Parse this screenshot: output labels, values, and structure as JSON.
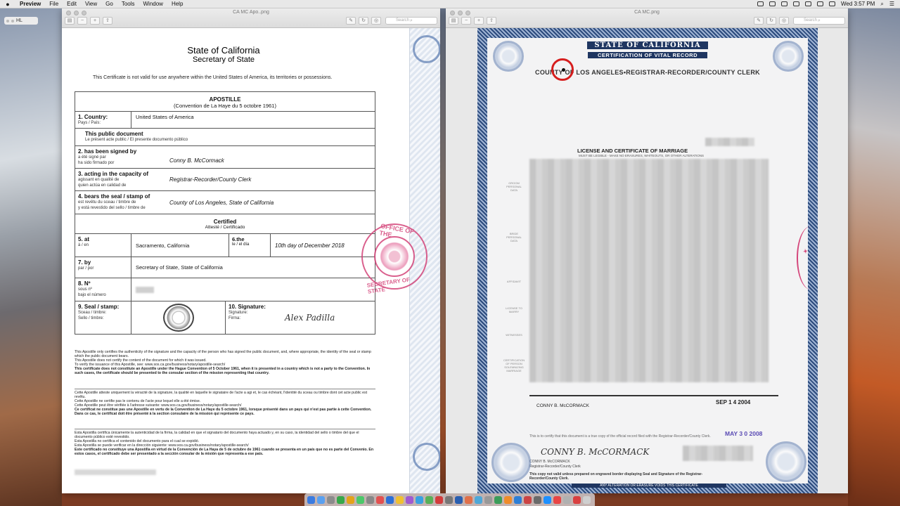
{
  "menubar": {
    "app": "Preview",
    "items": [
      "File",
      "Edit",
      "View",
      "Go",
      "Tools",
      "Window",
      "Help"
    ],
    "clock": "Wed 3:57 PM"
  },
  "desktop_chip": "HL",
  "left_window": {
    "title": "CA MC Apo..png",
    "search_placeholder": "Search",
    "doc": {
      "heading1": "State of California",
      "heading2": "Secretary of State",
      "note": "This Certificate is not valid for use anywhere within the United States of America, its territories or possessions.",
      "apostille_title": "APOSTILLE",
      "apostille_sub": "(Convention de La Haye du 5 octobre 1961)",
      "rows": {
        "country_label": "1.  Country:",
        "country_sub": "Pays / País:",
        "country_value": "United States of America",
        "public_doc": "This public document",
        "public_doc_sub": "Le présent acte public / El presente documento público",
        "signed_label": "2.  has been signed by",
        "signed_sub1": "a été signé par",
        "signed_sub2": "ha sido firmado por",
        "signed_value": "Conny B. McCormack",
        "capacity_label": "3.  acting in the capacity of",
        "capacity_sub1": "agissant en qualité de",
        "capacity_sub2": "quien actúa en calidad de",
        "capacity_value": "Registrar-Recorder/County Clerk",
        "seal_label": "4.  bears the seal / stamp of",
        "seal_sub1": "est revêtu du sceau / timbre de",
        "seal_sub2": "y está revestido del sello / timbre de",
        "seal_value": "County of Los Angeles,  State of California",
        "certified": "Certified",
        "certified_sub": "Attesté / Certificado",
        "at_label": "5.  at",
        "at_sub": "à / en",
        "at_value": "Sacramento, California",
        "the_label": "6.the",
        "the_sub": "le / el día",
        "the_value": "10th day of December 2018",
        "by_label": "7.  by",
        "by_sub": "par / por",
        "by_value": "Secretary of State, State of California",
        "no_label": "8.  Nº",
        "no_sub1": "sous nº",
        "no_sub2": "bajo el número",
        "sealstamp_label": "9.  Seal / stamp:",
        "sealstamp_sub1": "Sceau / timbre:",
        "sealstamp_sub2": "Sello / timbre:",
        "signature_label": "10.  Signature:",
        "signature_sub1": "Signature:",
        "signature_sub2": "Firma:",
        "signature_value": "Alex Padilla"
      },
      "fine_en_1": "This Apostille only certifies the authenticity of the signature and the capacity of the person who has signed the public document, and, where appropriate, the identity of the seal or stamp which the public document bears.",
      "fine_en_2": "This Apostille does not certify the content of the document for which it was issued.",
      "fine_en_3": "To verify the issuance of this Apostille, see: www.sos.ca.gov/business/notary/apostille-search/",
      "fine_en_4": "This certificate does not constitute an Apostille under the Hague Convention of 5 October 1961, when it is presented in a country which is not a party to the Convention.  In such cases, the certificate should be presented to the consular section of the mission representing that country.",
      "fine_fr_1": "Cette Apostille atteste uniquement la véracité de la signature, la qualité en laquelle le signataire de l'acte a agi et, le cas échéant, l'identité du sceau ou timbre dont cet acte public est revêtu.",
      "fine_fr_2": "Cette Apostille ne certifie pas le contenu de l'acte pour lequel elle a été émise.",
      "fine_fr_3": "Cette Apostille peut être vérifiée à l'adresse suivante: www.sos.ca.gov/business/notary/apostille-search/",
      "fine_fr_4": "Ce certificat ne constitue pas une Apostille en vertu de la Convention de La Haye du 5 octobre 1961, lorsque présenté dans un pays qui n'est pas partie à cette Convention.  Dans ce cas, le certificat doit être présenté à la section consulaire de la mission qui représente ce pays.",
      "fine_es_1": "Esta Apostilla certifica únicamente la autenticidad de la firma, la calidad en que el signatario del documento haya actuado y, en su caso, la identidad del sello o timbre del que el documento público esté revestido.",
      "fine_es_2": "Esta Apostilla no certifica el contenido del documento para el cual se expidió.",
      "fine_es_3": "Esta Apostilla se puede verificar en la dirección siguiente: www.sos.ca.gov/business/notary/apostille-search/",
      "fine_es_4": "Este certificado no constituye una Apostilla en virtud de la Convención de La Haya de 5 de octubre de 1961 cuando se presenta en un país que no es parte del Convenio.  En estos casos, el certificado debe ser presentado a la sección consular de la misión que representa a ese país.",
      "red_seal_top": "OFFICE OF THE",
      "red_seal_bottom": "SECRETARY OF STATE"
    }
  },
  "right_window": {
    "title": "CA MC.png",
    "search_placeholder": "Search",
    "cert": {
      "band1": "STATE OF CALIFORNIA",
      "band2": "CERTIFICATION OF VITAL RECORD",
      "county": "COUNTY OF LOS ANGELES•REGISTRAR-RECORDER/COUNTY CLERK",
      "license_title": "LICENSE AND CERTIFICATE OF MARRIAGE",
      "license_sub": "MUST BE LEGIBLE - MAKE NO ERASURES, WHITEOUTS, OR OTHER ALTERATIONS",
      "left_labels": [
        "GROOM PERSONAL DATA",
        "BRIDE PERSONAL DATA",
        "AFFIDAVIT",
        "LICENSE TO MARRY",
        "WITNESSES",
        "CERTIFICATION OF PERSON SOLEMNIZING MARRIAGE"
      ],
      "registrar": "CONNY B. McCORMACK",
      "date_accepted": "SEP 1 4 2004",
      "note": "This is to certify that this document is a true copy of the official record filed with the Registrar-Recorder/County Clerk.",
      "date_stamp": "MAY 3 0 2008",
      "sig_name": "CONNY B. McCORMACK",
      "sig_title": "Registrar-Recorder/County Clerk",
      "valid_note": "This copy not valid unless prepared on engraved border displaying Seal and Signature of the Registrar-Recorder/County Clerk.",
      "bottom_band": "ANY ALTERATION OR ERASURE VOIDS THIS CERTIFICATE"
    }
  },
  "dock_colors": [
    "#3b7be0",
    "#5aa0f0",
    "#8c8c8c",
    "#37a84a",
    "#e4a21a",
    "#4cc86a",
    "#888888",
    "#e35050",
    "#2b6fd8",
    "#f0c030",
    "#a05ad0",
    "#3aa0e0",
    "#58b058",
    "#d33c3c",
    "#777777",
    "#2a5fb0",
    "#e0704a",
    "#4fa8d8",
    "#999999",
    "#3c9d5a",
    "#ef8c2a",
    "#2e7fd6",
    "#c44",
    "#6a6a6a",
    "#1e90ff",
    "#e84545",
    "#b0b0b0",
    "#d94040",
    "#cfcfcf"
  ]
}
